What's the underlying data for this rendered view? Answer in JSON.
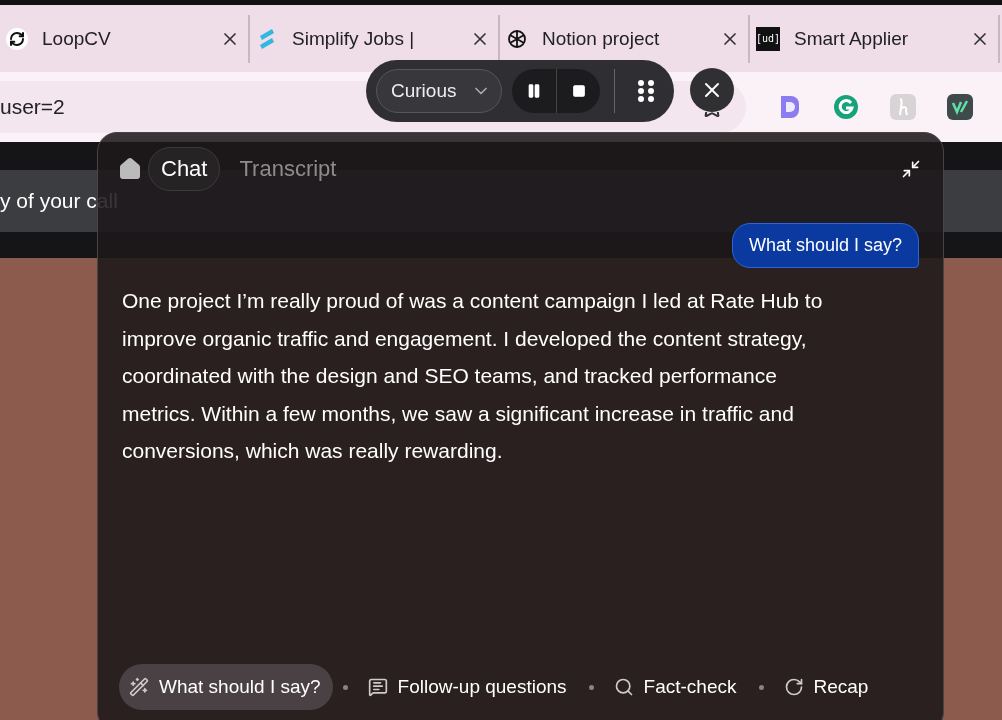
{
  "browser": {
    "tabs": [
      {
        "title": "LoopCV",
        "selected": false
      },
      {
        "title": "Simplify Jobs |",
        "selected": false
      },
      {
        "title": "Notion project",
        "selected": false
      },
      {
        "title": "Smart Applier",
        "icon_text": "[ud]",
        "selected": false
      }
    ],
    "address": "user=2"
  },
  "page": {
    "banner_text": "y of your call"
  },
  "call_controls": {
    "mood": "Curious"
  },
  "panel": {
    "tabs": [
      {
        "label": "Chat",
        "selected": true
      },
      {
        "label": "Transcript",
        "selected": false
      }
    ],
    "question": "What should I say?",
    "answer": "One project I’m really proud of was a content campaign I led at Rate Hub to improve organic traffic and engagement. I developed the content strategy, coordinated with the design and SEO teams, and tracked performance metrics. Within a few months, we saw a significant increase in traffic and conversions, which was really rewarding.",
    "actions": [
      {
        "label": "What should I say?",
        "selected": true
      },
      {
        "label": "Follow-up questions",
        "selected": false
      },
      {
        "label": "Fact-check",
        "selected": false
      },
      {
        "label": "Recap",
        "selected": false
      }
    ]
  }
}
